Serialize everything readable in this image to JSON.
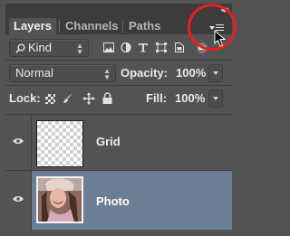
{
  "panel": {
    "collapse_glyph": "◂◂",
    "tabs": [
      {
        "label": "Layers",
        "active": true
      },
      {
        "label": "Channels",
        "active": false
      },
      {
        "label": "Paths",
        "active": false
      }
    ]
  },
  "filter": {
    "kind_label": "Kind",
    "filter_icons": [
      "image-filter-icon",
      "adjustment-filter-icon",
      "type-filter-icon",
      "shape-filter-icon",
      "smart-object-filter-icon"
    ]
  },
  "blend": {
    "mode": "Normal",
    "opacity_label": "Opacity:",
    "opacity_value": "100%"
  },
  "lock": {
    "label": "Lock:",
    "icons": [
      "lock-transparent-pixels-icon",
      "lock-image-pixels-icon",
      "lock-position-icon",
      "lock-all-icon"
    ],
    "fill_label": "Fill:",
    "fill_value": "100%"
  },
  "layers": [
    {
      "name": "Grid",
      "visible": true,
      "selected": false
    },
    {
      "name": "Photo",
      "visible": true,
      "selected": true
    }
  ],
  "colors": {
    "panel_bg": "#535353",
    "selected_layer": "#6c7e93",
    "highlight_circle": "#e8201b"
  }
}
